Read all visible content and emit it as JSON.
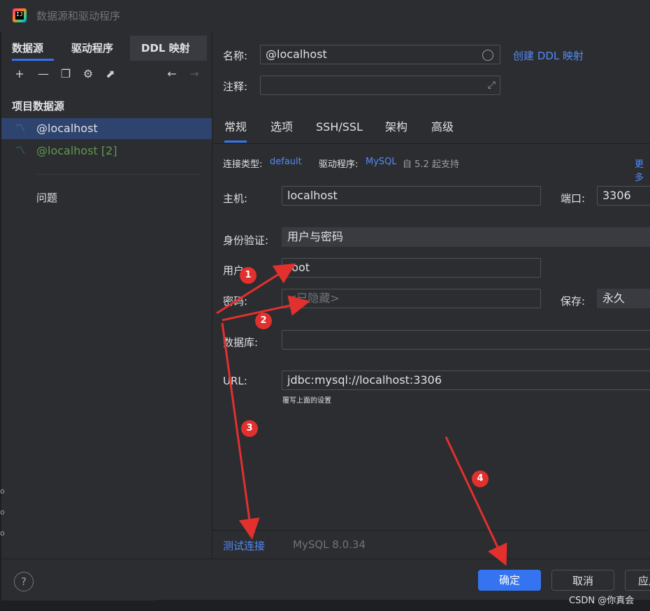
{
  "window": {
    "title": "数据源和驱动程序"
  },
  "left": {
    "tabs": [
      "数据源",
      "驱动程序",
      "DDL 映射"
    ],
    "section": "项目数据源",
    "datasources": [
      {
        "label": "@localhost",
        "color": "#dfe1e5"
      },
      {
        "label": "@localhost [2]",
        "color": "#5f9a4c"
      }
    ],
    "problems": "问题"
  },
  "right": {
    "name_label": "名称:",
    "name_value": "@localhost",
    "create_ddl_link": "创建 DDL 映射",
    "comment_label": "注释:",
    "comment_value": "",
    "tabs": [
      "常规",
      "选项",
      "SSH/SSL",
      "架构",
      "高级"
    ],
    "conn_type_label": "连接类型:",
    "conn_type_value": "default",
    "driver_label": "驱动程序:",
    "driver_value": "MySQL",
    "driver_note": "自 5.2 起支持",
    "more": "更多",
    "host_label": "主机:",
    "host_value": "localhost",
    "port_label": "端口:",
    "port_value": "3306",
    "auth_label": "身份验证:",
    "auth_value": "用户与密码",
    "user_label": "用户:",
    "user_value": "root",
    "password_label": "密码:",
    "password_placeholder": "<已隐藏>",
    "save_label": "保存:",
    "save_value": "永久",
    "database_label": "数据库:",
    "database_value": "",
    "url_label": "URL:",
    "url_value": "jdbc:mysql://localhost:3306",
    "url_hint": "覆写上面的设置",
    "test_connection": "测试连接",
    "server_version": "MySQL 8.0.34"
  },
  "buttons": {
    "ok": "确定",
    "cancel": "取消",
    "apply": "应用",
    "help": "?"
  },
  "annotations": [
    "1",
    "2",
    "3",
    "4"
  ],
  "watermark": "CSDN @你真会",
  "colors": {
    "accent": "#3574f0",
    "link": "#548af7",
    "annotation": "#e2302e"
  }
}
